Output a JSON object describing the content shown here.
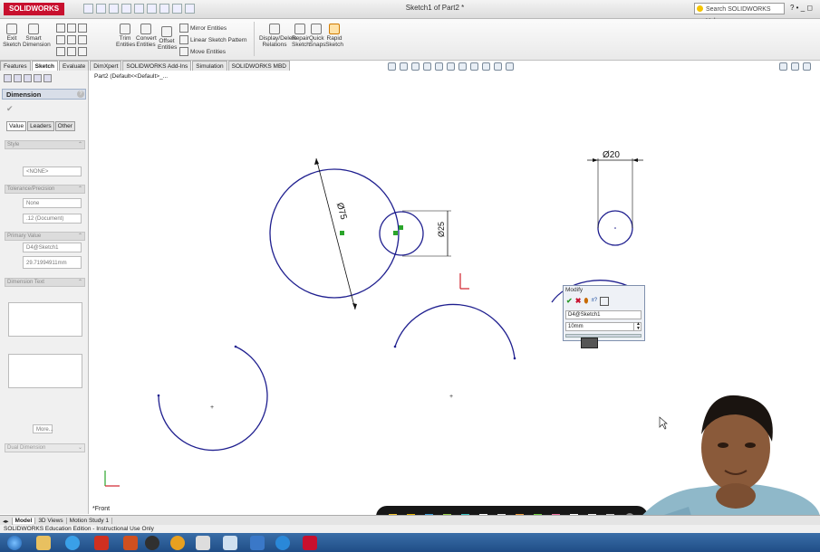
{
  "app": {
    "logo_text": "SOLIDWORKS",
    "document_title": "Sketch1 of Part2 *",
    "search_placeholder": "Search SOLIDWORKS Help",
    "window_controls": "? • _ ◻"
  },
  "ribbon": {
    "exit_sketch": "Exit Sketch",
    "smart_dimension": "Smart Dimension",
    "trim_entities": "Trim Entities",
    "convert_entities": "Convert Entities",
    "offset_entities": "Offset Entities",
    "mirror_entities": "Mirror Entities",
    "linear_sketch_pattern": "Linear Sketch Pattern",
    "move_entities": "Move Entities",
    "display_delete_relations": "Display/Delete Relations",
    "repair_sketch": "Repair Sketch",
    "quick_snaps": "Quick Snaps",
    "rapid_sketch": "Rapid Sketch"
  },
  "tabs": [
    "Features",
    "Sketch",
    "Evaluate",
    "DimXpert",
    "SOLIDWORKS Add-Ins",
    "Simulation",
    "SOLIDWORKS MBD"
  ],
  "tree": {
    "part_label": "Part2 (Default<<Default>_..."
  },
  "property_manager": {
    "title": "Dimension",
    "sub_tabs": [
      "Value",
      "Leaders",
      "Other"
    ],
    "style_group": "Style",
    "style_value": "<NONE>",
    "tolerance_group": "Tolerance/Precision",
    "tolerance_value": "None",
    "precision_value": ".12 (Document)",
    "primary_value_group": "Primary Value",
    "primary_name": "D4@Sketch1",
    "primary_value": "29.71994911mm",
    "dimension_text_group": "Dimension Text",
    "more_label": "More...",
    "dual_dimension": "Dual Dimension"
  },
  "canvas": {
    "dim_75": "Ø75",
    "dim_25": "Ø25",
    "dim_20": "Ø20",
    "view_label": "*Front"
  },
  "modify_dialog": {
    "title": "Modify",
    "name": "D4@Sketch1",
    "value": "10mm"
  },
  "bottom_tabs": [
    "Model",
    "3D Views",
    "Motion Study 1"
  ],
  "status_bar": "SOLIDWORKS Education Edition - Instructional Use Only",
  "colors": {
    "sketch_line": "#1f1f8f",
    "dimension": "#111111",
    "accent_red": "#c8102e",
    "taskbar": "#2a5c98"
  }
}
